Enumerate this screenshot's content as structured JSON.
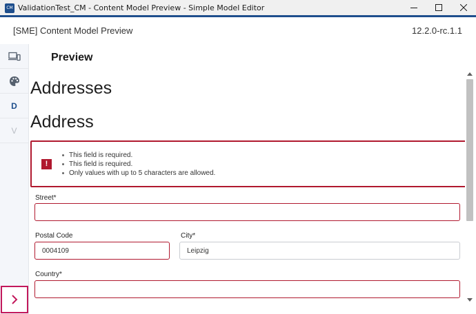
{
  "window": {
    "title": "ValidationTest_CM - Content Model Preview - Simple Model Editor",
    "icon_text": "CM"
  },
  "header": {
    "title": "[SME] Content Model Preview",
    "version": "12.2.0-rc.1.1"
  },
  "sidebar": {
    "items": [
      {
        "name": "devices-icon"
      },
      {
        "name": "palette-icon"
      },
      {
        "label": "D",
        "color": "#1e4e8c"
      },
      {
        "label": "V",
        "color": "#b8bcc4"
      }
    ]
  },
  "preview": {
    "title": "Preview",
    "heading_addresses": "Addresses",
    "heading_address": "Address"
  },
  "errors": {
    "icon_text": "!",
    "messages": [
      "This field is required.",
      "This field is required.",
      "Only values with up to 5 characters are allowed."
    ]
  },
  "form": {
    "street": {
      "label": "Street*",
      "value": ""
    },
    "postal_code": {
      "label": "Postal Code",
      "value": "0004109"
    },
    "city": {
      "label": "City*",
      "value": "Leipzig"
    },
    "country": {
      "label": "Country*",
      "value": ""
    }
  },
  "colors": {
    "accent": "#1e4e8c",
    "error": "#b0182e",
    "expand_border": "#c2185b"
  }
}
